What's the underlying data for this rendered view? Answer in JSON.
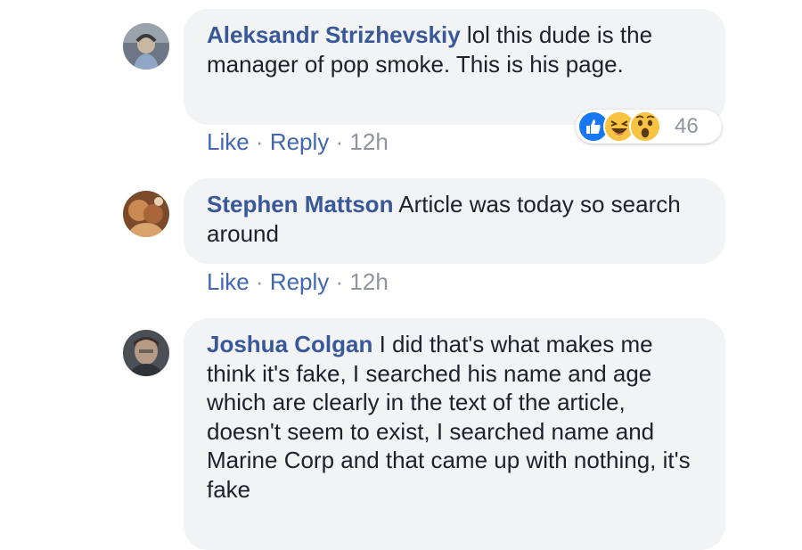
{
  "comments": [
    {
      "author": "Aleksandr Strizhevskiy",
      "text": " lol this dude is the manager of pop smoke. This is his page.",
      "like_label": "Like",
      "reply_label": "Reply",
      "separator": " · ",
      "time": "12h",
      "avatar_icon": "avatar-photo",
      "reactions": {
        "icons": [
          "like-reaction-icon",
          "haha-reaction-icon",
          "wow-reaction-icon"
        ],
        "count": "46"
      }
    },
    {
      "author": "Stephen Mattson",
      "text": " Article was today so search around",
      "like_label": "Like",
      "reply_label": "Reply",
      "separator": " · ",
      "time": "12h",
      "avatar_icon": "avatar-photo"
    },
    {
      "author": "Joshua Colgan",
      "text": " I did that's what makes me think it's fake, I searched his name and age which are clearly in the text of the article, doesn't seem to exist, I searched name and Marine Corp and that came up with nothing, it's fake",
      "avatar_icon": "avatar-photo"
    }
  ],
  "colors": {
    "author": "#385898",
    "link": "#4267b2",
    "meta": "#90949c",
    "bubble": "#f2f3f5",
    "like_blue": "#1877f2",
    "emoji_yellow": "#f7c343"
  }
}
